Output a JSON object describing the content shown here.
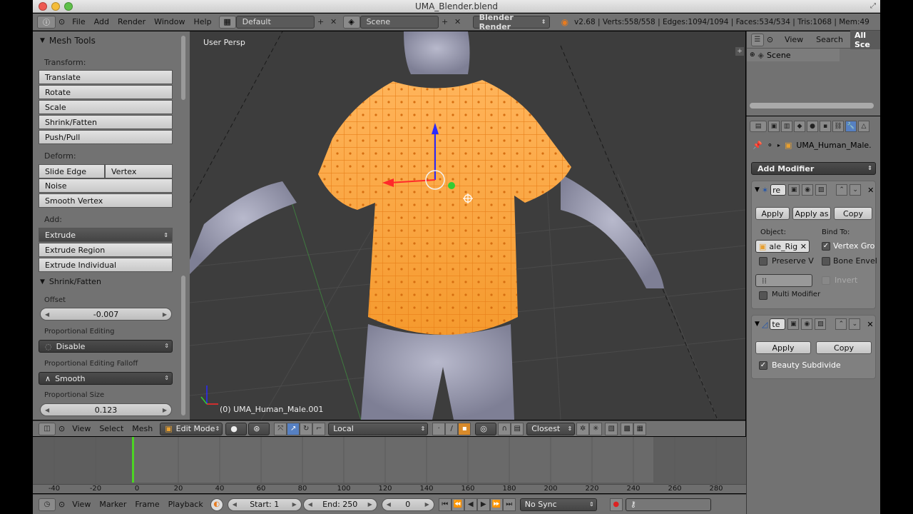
{
  "window": {
    "title": "UMA_Blender.blend"
  },
  "info_header": {
    "menus": [
      "File",
      "Add",
      "Render",
      "Window",
      "Help"
    ],
    "screen_layout": "Default",
    "scene": "Scene",
    "render_engine": "Blender Render",
    "stats": "v2.68 | Verts:558/558 | Edges:1094/1094 | Faces:534/534 | Tris:1068 | Mem:49"
  },
  "toolshelf": {
    "panel_title": "Mesh Tools",
    "transform_label": "Transform:",
    "transform_buttons": [
      "Translate",
      "Rotate",
      "Scale",
      "Shrink/Fatten",
      "Push/Pull"
    ],
    "deform_label": "Deform:",
    "slide_edge": "Slide Edge",
    "vertex": "Vertex",
    "noise": "Noise",
    "smooth_vertex": "Smooth Vertex",
    "add_label": "Add:",
    "extrude": "Extrude",
    "extrude_region": "Extrude Region",
    "extrude_individual": "Extrude Individual",
    "operator_title": "Shrink/Fatten",
    "offset_label": "Offset",
    "offset_value": "-0.007",
    "prop_editing_label": "Proportional Editing",
    "prop_editing_value": "Disable",
    "falloff_label": "Proportional Editing Falloff",
    "falloff_value": "Smooth",
    "prop_size_label": "Proportional Size",
    "prop_size_value": "0.123"
  },
  "viewport": {
    "view_label": "User Persp",
    "object_label": "(0) UMA_Human_Male.001",
    "colors": {
      "background": "#3d3d3d",
      "selected": "#ffa030",
      "mesh": "#9a9bb0"
    }
  },
  "view3d_header": {
    "menus": [
      "View",
      "Select",
      "Mesh"
    ],
    "mode": "Edit Mode",
    "orientation": "Local",
    "snap_target": "Closest"
  },
  "timeline": {
    "ticks": [
      "-40",
      "-20",
      "0",
      "20",
      "40",
      "60",
      "80",
      "100",
      "120",
      "140",
      "160",
      "180",
      "200",
      "220",
      "240",
      "260",
      "280"
    ],
    "current_frame": 0,
    "menus": [
      "View",
      "Marker",
      "Frame",
      "Playback"
    ],
    "start": "Start: 1",
    "end": "End: 250",
    "frame": "0",
    "sync": "No Sync"
  },
  "outliner": {
    "view": "View",
    "search": "Search",
    "filter": "All Sce",
    "root": "Scene"
  },
  "properties": {
    "object_name": "UMA_Human_Male.",
    "add_modifier": "Add Modifier",
    "mod1": {
      "name": "re",
      "apply": "Apply",
      "apply_as": "Apply as",
      "copy": "Copy",
      "object_label": "Object:",
      "object_value": "ale_Rig",
      "bind_to": "Bind To:",
      "vertex_groups": "Vertex Gro",
      "preserve": "Preserve V",
      "bone_env": "Bone Envel",
      "invert": "Invert",
      "multi": "Multi Modifier"
    },
    "mod2": {
      "name": "te",
      "apply": "Apply",
      "copy": "Copy",
      "beauty": "Beauty Subdivide"
    }
  }
}
